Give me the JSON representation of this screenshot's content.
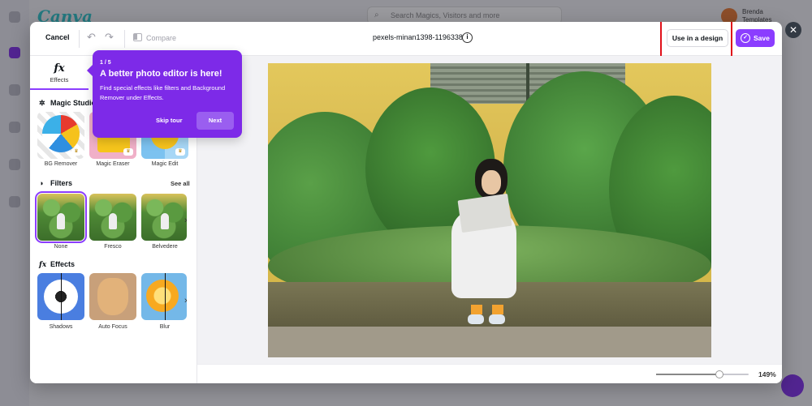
{
  "background": {
    "search_placeholder": "Search Magics, Visitors and more",
    "user_name": "Brenda",
    "user_sub": "Templates"
  },
  "topbar": {
    "cancel_label": "Cancel",
    "compare_label": "Compare",
    "filename": "pexels-minan1398-1196338",
    "use_in_design_label": "Use in a design",
    "save_label": "Save"
  },
  "panel": {
    "tab_label": "Effects",
    "magic_studio_title": "Magic Studio",
    "magic_tools": [
      {
        "label": "BG Remover"
      },
      {
        "label": "Magic Eraser"
      },
      {
        "label": "Magic Edit"
      }
    ],
    "filters_title": "Filters",
    "see_all_label": "See all",
    "filters": [
      {
        "label": "None"
      },
      {
        "label": "Fresco"
      },
      {
        "label": "Belvedere"
      }
    ],
    "effects_title": "Effects",
    "effects": [
      {
        "label": "Shadows"
      },
      {
        "label": "Auto Focus"
      },
      {
        "label": "Blur"
      }
    ]
  },
  "tour": {
    "step": "1 / 5",
    "title": "A better photo editor is here!",
    "body": "Find special effects like filters and Background Remover under Effects.",
    "skip_label": "Skip tour",
    "next_label": "Next"
  },
  "zoom": {
    "value_percent": 149,
    "label": "149%",
    "slider_fraction": 0.68
  },
  "colors": {
    "accent": "#8b3dff",
    "tour_bg": "#7d2ae8",
    "highlight": "#e0101a"
  }
}
